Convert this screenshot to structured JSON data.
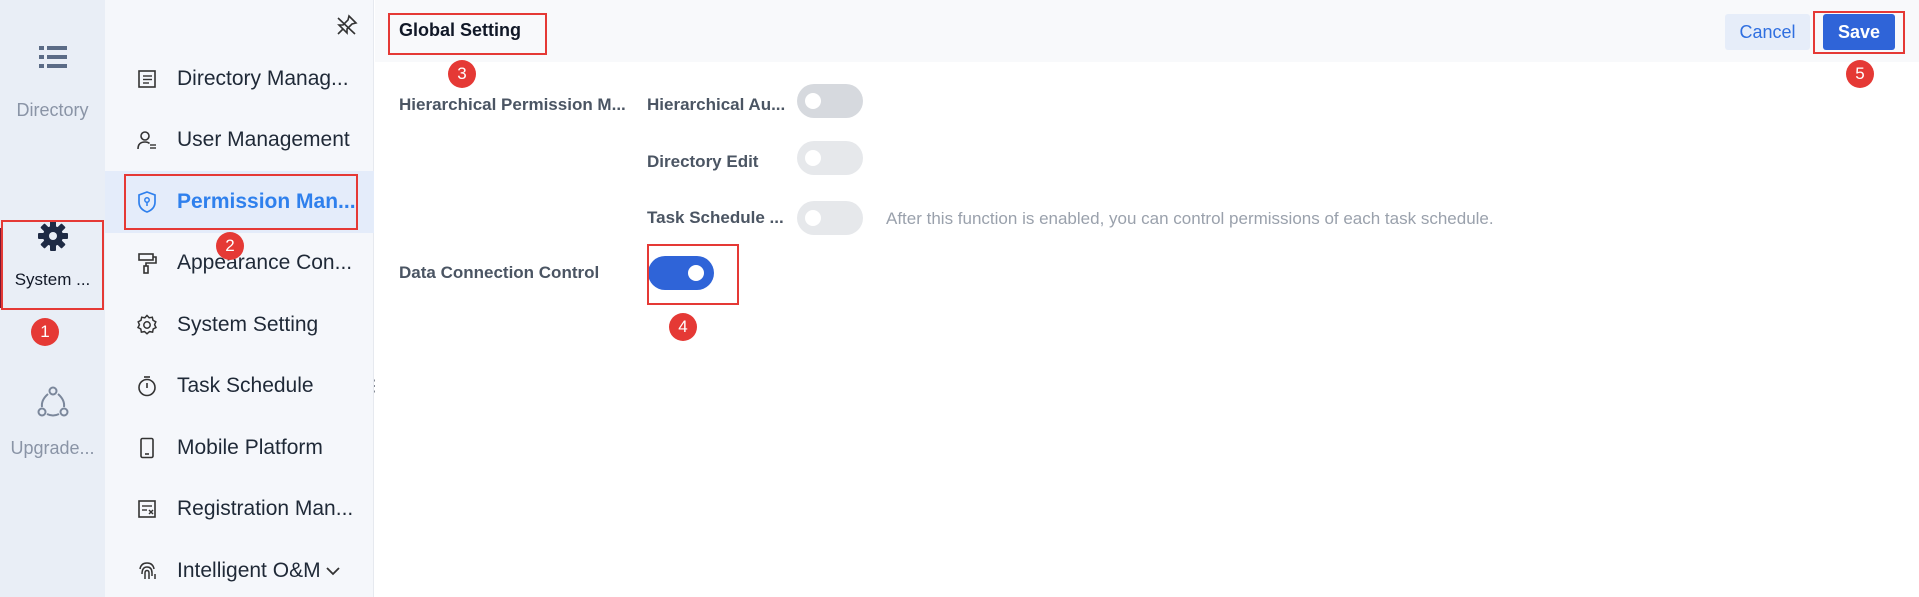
{
  "rail": {
    "items": [
      {
        "label": "Directory",
        "icon": "list-icon"
      },
      {
        "label": "System ...",
        "icon": "gear-icon"
      },
      {
        "label": "Upgrade...",
        "icon": "upgrade-icon"
      }
    ]
  },
  "sidebar": {
    "items": [
      {
        "label": "Directory Manag...",
        "icon": "document-list-icon"
      },
      {
        "label": "User Management",
        "icon": "user-icon"
      },
      {
        "label": "Permission Man...",
        "icon": "shield-icon"
      },
      {
        "label": "Appearance Con...",
        "icon": "paint-roller-icon"
      },
      {
        "label": "System Setting",
        "icon": "gear-outline-icon"
      },
      {
        "label": "Task Schedule",
        "icon": "stopwatch-icon"
      },
      {
        "label": "Mobile Platform",
        "icon": "mobile-icon"
      },
      {
        "label": "Registration Man...",
        "icon": "registration-icon"
      },
      {
        "label": "Intelligent O&M",
        "icon": "fingerprint-icon"
      }
    ]
  },
  "header": {
    "title": "Global Setting",
    "cancel_label": "Cancel",
    "save_label": "Save"
  },
  "settings": {
    "group_label": "Hierarchical Permission M...",
    "rows": [
      {
        "label": "Hierarchical Au...",
        "enabled": false
      },
      {
        "label": "Directory Edit",
        "enabled": false
      },
      {
        "label": "Task Schedule ...",
        "enabled": false,
        "hint": "After this function is enabled, you can control permissions of each task schedule."
      }
    ],
    "data_connection": {
      "label": "Data Connection Control",
      "enabled": true
    }
  },
  "annotations": [
    "1",
    "2",
    "3",
    "4",
    "5"
  ],
  "colors": {
    "accent": "#2f64d8",
    "active_nav_text": "#2f80ed",
    "annotation": "#e53935"
  }
}
